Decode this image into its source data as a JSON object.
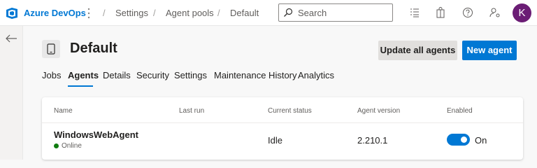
{
  "topbar": {
    "brand": "Azure DevOps",
    "breadcrumbs": [
      "Settings",
      "Agent pools",
      "Default"
    ],
    "separator": "/",
    "search_placeholder": "Search",
    "avatar_initial": "K",
    "icons": [
      "list-icon",
      "shopping-bag-icon",
      "help-icon",
      "user-settings-icon"
    ]
  },
  "header": {
    "title": "Default",
    "update_button": "Update all agents",
    "new_button": "New agent"
  },
  "tabs": [
    {
      "label": "Jobs",
      "active": false
    },
    {
      "label": "Agents",
      "active": true
    },
    {
      "label": "Details",
      "active": false
    },
    {
      "label": "Security",
      "active": false
    },
    {
      "label": "Settings",
      "active": false
    },
    {
      "label": "Maintenance History",
      "active": false
    },
    {
      "label": "Analytics",
      "active": false
    }
  ],
  "table": {
    "columns": [
      "Name",
      "Last run",
      "Current status",
      "Agent version",
      "Enabled"
    ],
    "rows": [
      {
        "name": "WindowsWebAgent",
        "status_dot": "Online",
        "last_run": "",
        "current_status": "Idle",
        "version": "2.210.1",
        "enabled": true,
        "enabled_label": "On"
      }
    ]
  },
  "colors": {
    "accent": "#0078d4",
    "online": "#107c10",
    "avatar": "#6b1d75"
  }
}
